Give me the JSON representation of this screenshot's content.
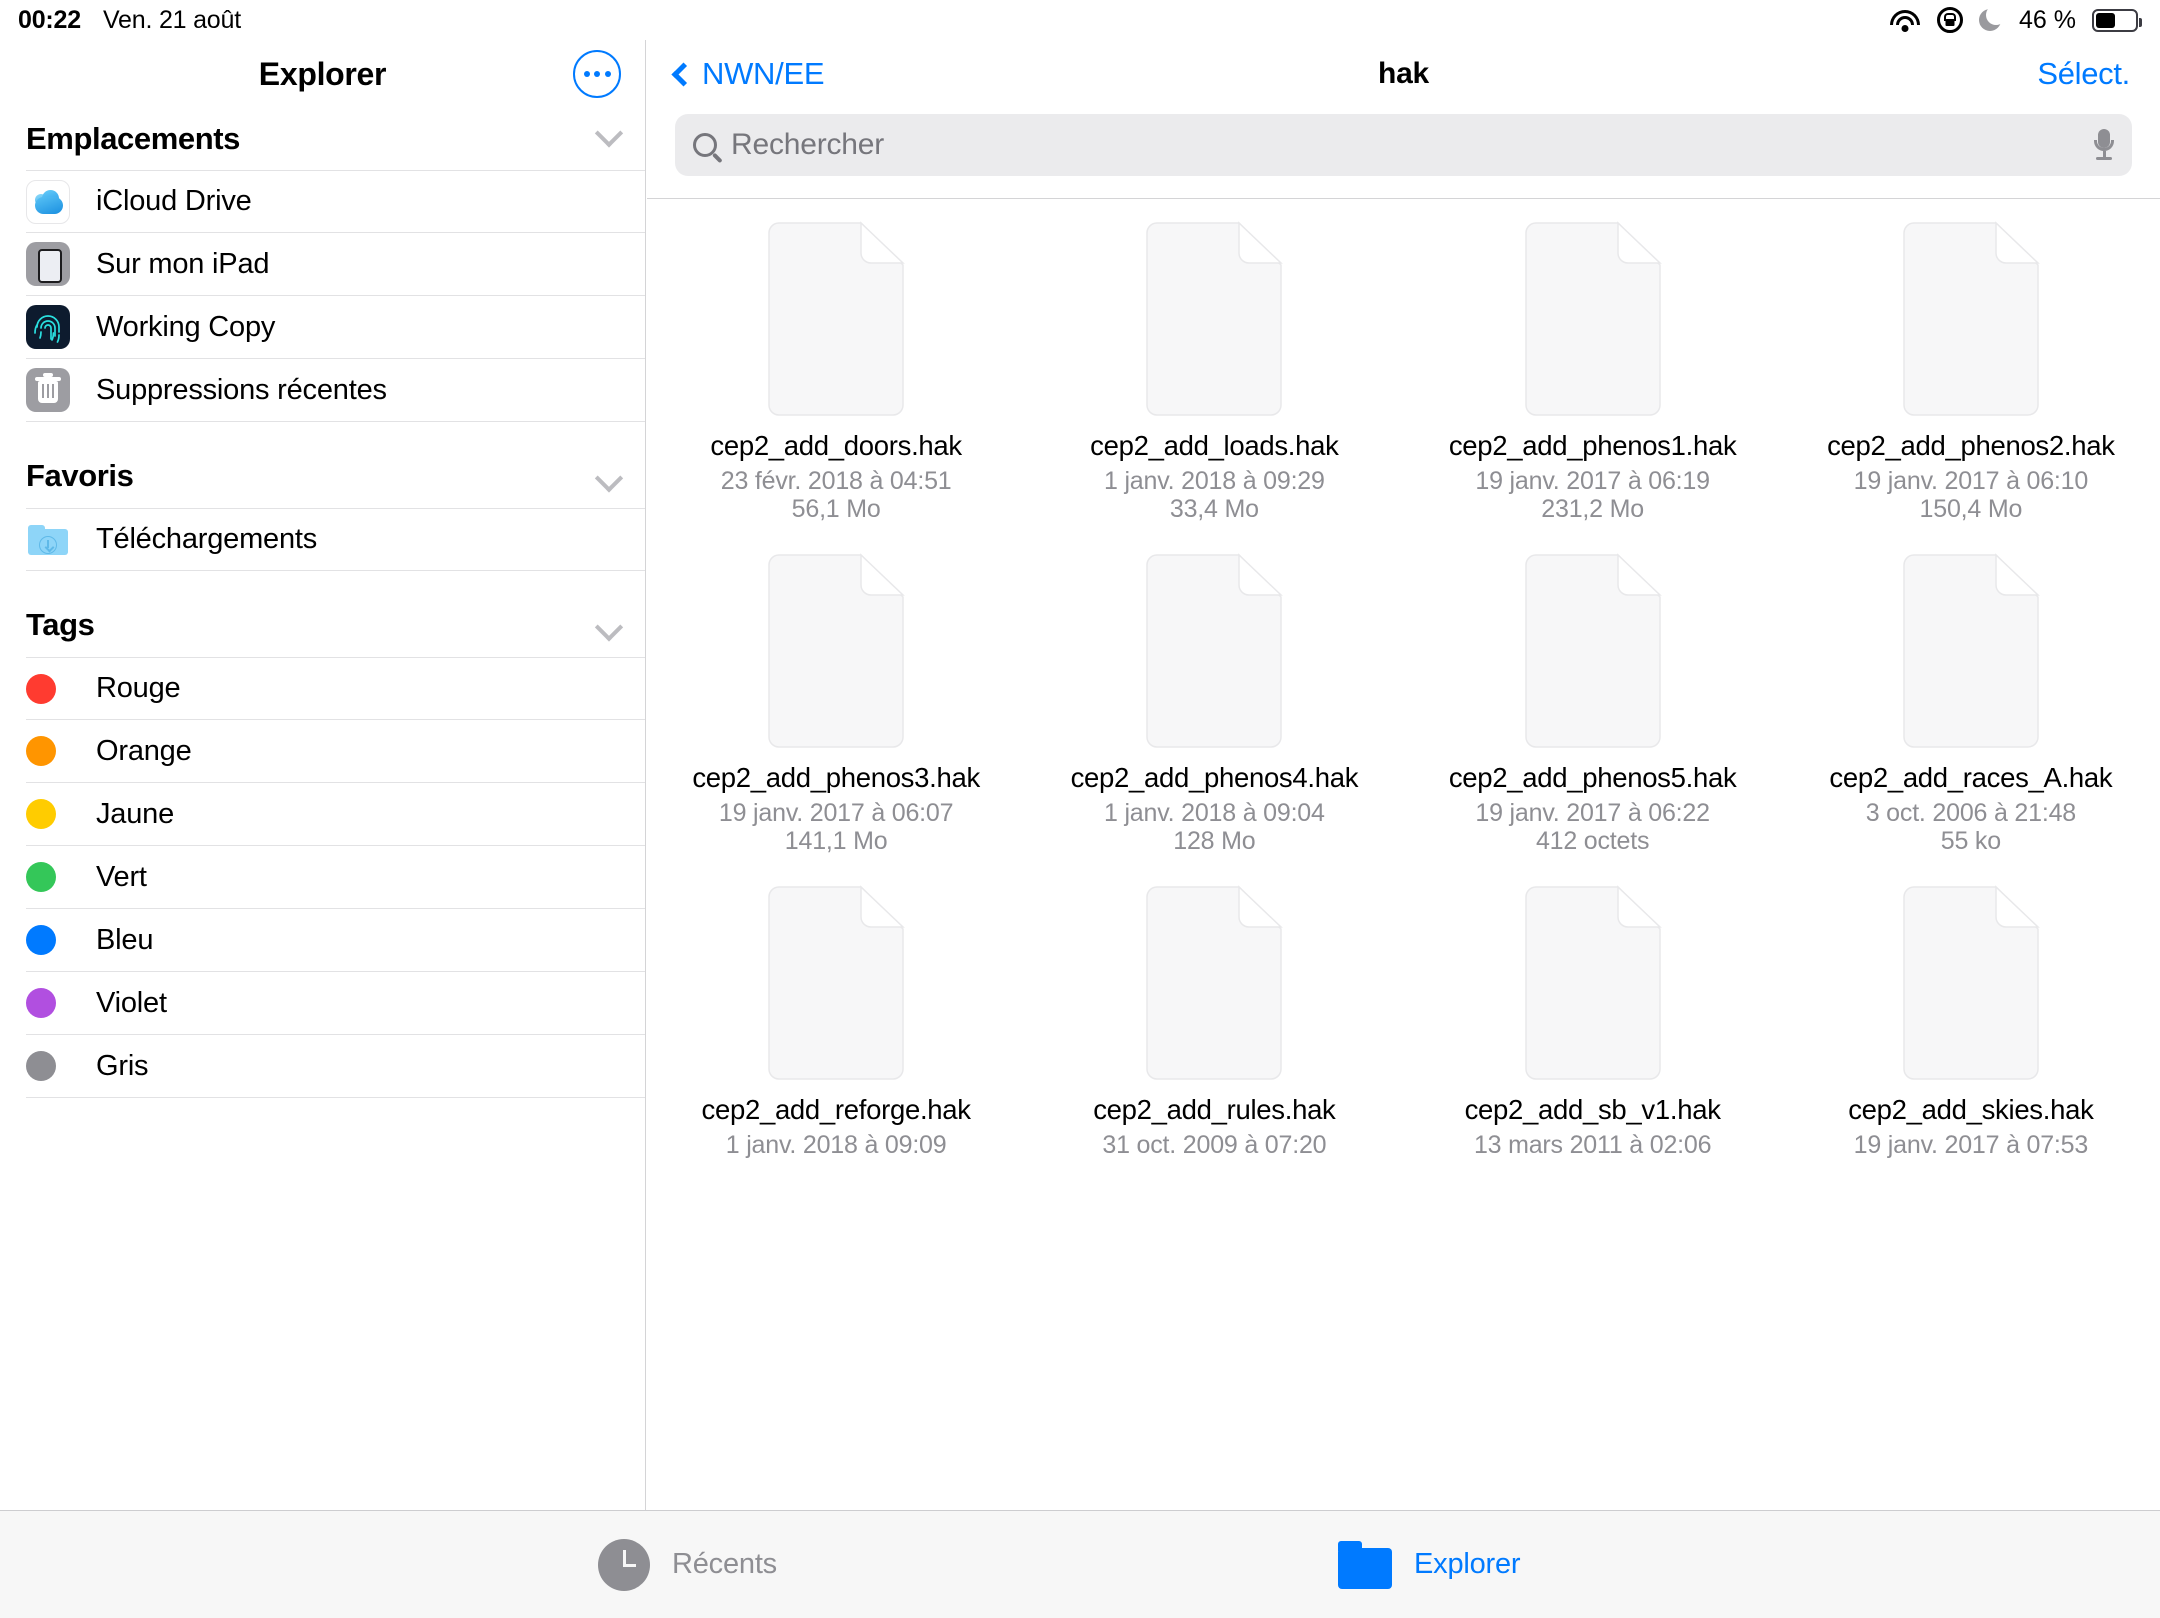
{
  "statusbar": {
    "time": "00:22",
    "date": "Ven. 21 août",
    "battery_percent": "46 %",
    "icons": [
      "wifi-icon",
      "rotation-lock-icon",
      "moon-icon",
      "battery-icon"
    ]
  },
  "sidebar": {
    "title": "Explorer",
    "more_button": "more-icon",
    "sections": [
      {
        "title": "Emplacements",
        "items": [
          {
            "label": "iCloud Drive",
            "icon": "icloud-drive-icon"
          },
          {
            "label": "Sur mon iPad",
            "icon": "ipad-icon"
          },
          {
            "label": "Working Copy",
            "icon": "working-copy-fingerprint-icon"
          },
          {
            "label": "Suppressions récentes",
            "icon": "trash-icon"
          }
        ]
      },
      {
        "title": "Favoris",
        "items": [
          {
            "label": "Téléchargements",
            "icon": "downloads-folder-icon"
          }
        ]
      },
      {
        "title": "Tags",
        "items": [
          {
            "label": "Rouge",
            "color": "#ff3b30"
          },
          {
            "label": "Orange",
            "color": "#ff9500"
          },
          {
            "label": "Jaune",
            "color": "#ffcc00"
          },
          {
            "label": "Vert",
            "color": "#34c759"
          },
          {
            "label": "Bleu",
            "color": "#007aff"
          },
          {
            "label": "Violet",
            "color": "#b14fe0"
          },
          {
            "label": "Gris",
            "color": "#8e8e93"
          }
        ]
      }
    ]
  },
  "detail": {
    "back_label": "NWN/EE",
    "title": "hak",
    "select_label": "Sélect.",
    "search": {
      "placeholder": "Rechercher",
      "value": "",
      "search_icon": "search-icon",
      "mic_icon": "microphone-icon"
    },
    "files": [
      {
        "name": "cep2_add_doors.hak",
        "date": "23 févr. 2018 à 04:51",
        "size": "56,1 Mo"
      },
      {
        "name": "cep2_add_loads.hak",
        "date": "1 janv. 2018 à 09:29",
        "size": "33,4 Mo"
      },
      {
        "name": "cep2_add_phenos1.hak",
        "date": "19 janv. 2017 à 06:19",
        "size": "231,2 Mo"
      },
      {
        "name": "cep2_add_phenos2.hak",
        "date": "19 janv. 2017 à 06:10",
        "size": "150,4 Mo"
      },
      {
        "name": "cep2_add_phenos3.hak",
        "date": "19 janv. 2017 à 06:07",
        "size": "141,1 Mo"
      },
      {
        "name": "cep2_add_phenos4.hak",
        "date": "1 janv. 2018 à 09:04",
        "size": "128 Mo"
      },
      {
        "name": "cep2_add_phenos5.hak",
        "date": "19 janv. 2017 à 06:22",
        "size": "412 octets"
      },
      {
        "name": "cep2_add_races_A.hak",
        "date": "3 oct. 2006 à 21:48",
        "size": "55 ko"
      },
      {
        "name": "cep2_add_reforge.hak",
        "date": "1 janv. 2018 à 09:09",
        "size": ""
      },
      {
        "name": "cep2_add_rules.hak",
        "date": "31 oct. 2009 à 07:20",
        "size": ""
      },
      {
        "name": "cep2_add_sb_v1.hak",
        "date": "13 mars 2011 à 02:06",
        "size": ""
      },
      {
        "name": "cep2_add_skies.hak",
        "date": "19 janv. 2017 à 07:53",
        "size": ""
      }
    ]
  },
  "tabbar": {
    "tabs": [
      {
        "label": "Récents",
        "icon": "clock-icon",
        "active": false
      },
      {
        "label": "Explorer",
        "icon": "folder-icon",
        "active": true
      }
    ]
  },
  "colors": {
    "accent": "#007aff",
    "muted": "#8e8e93"
  }
}
